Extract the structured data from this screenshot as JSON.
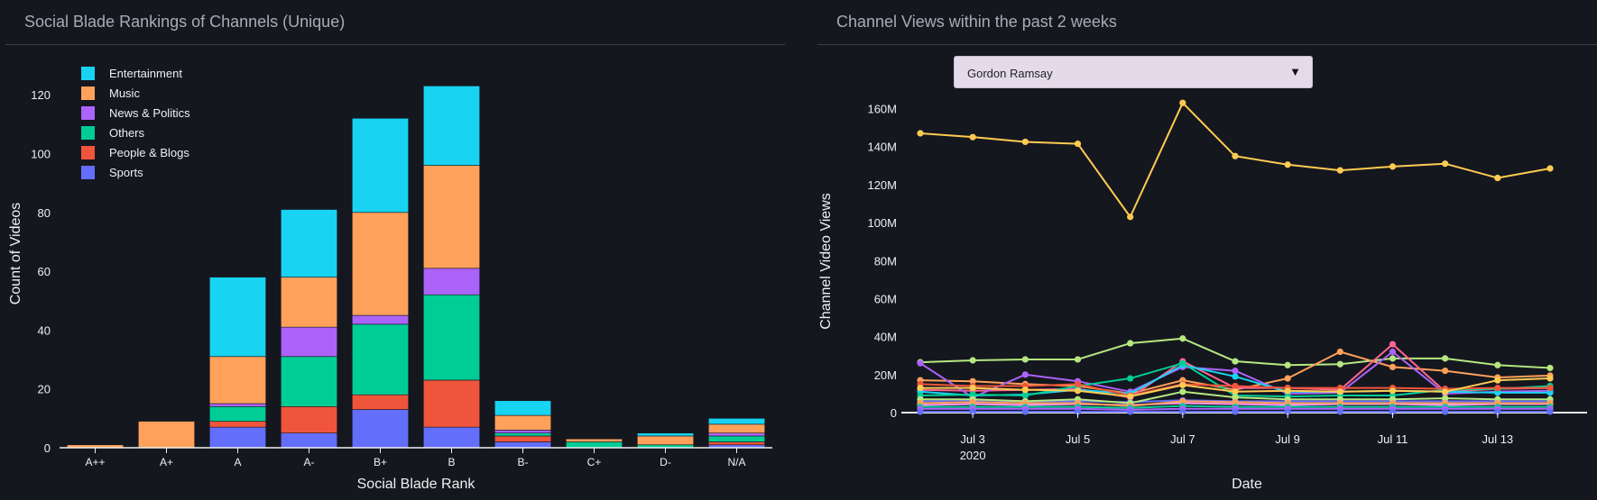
{
  "left_panel": {
    "title": "Social Blade Rankings of Channels (Unique)"
  },
  "right_panel": {
    "title": "Channel Views within the past 2 weeks",
    "dropdown": {
      "selected": "Gordon Ramsay"
    }
  },
  "chart_data": [
    {
      "type": "bar",
      "stacked": true,
      "xlabel": "Social Blade Rank",
      "ylabel": "Count of Videos",
      "ylim": [
        0,
        132
      ],
      "yticks": [
        0,
        20,
        40,
        60,
        80,
        100,
        120
      ],
      "grid": false,
      "legend_position": "top-left",
      "categories": [
        "A++",
        "A+",
        "A",
        "A-",
        "B+",
        "B",
        "B-",
        "C+",
        "D-",
        "N/A"
      ],
      "series": [
        {
          "name": "Sports",
          "color": "#636efa",
          "values": [
            0,
            0,
            7,
            5,
            13,
            7,
            2,
            0,
            0,
            1
          ]
        },
        {
          "name": "People & Blogs",
          "color": "#ef553b",
          "values": [
            0,
            0,
            2,
            9,
            5,
            16,
            2,
            0,
            0,
            1
          ]
        },
        {
          "name": "Others",
          "color": "#00cc96",
          "values": [
            0,
            0,
            5,
            17,
            24,
            29,
            1,
            2,
            1,
            2
          ]
        },
        {
          "name": "News & Politics",
          "color": "#ab63fa",
          "values": [
            0,
            0,
            1,
            10,
            3,
            9,
            1,
            0,
            0,
            1
          ]
        },
        {
          "name": "Music",
          "color": "#ffa15a",
          "values": [
            1,
            9,
            16,
            17,
            35,
            35,
            5,
            1,
            3,
            3
          ]
        },
        {
          "name": "Entertainment",
          "color": "#19d3f3",
          "values": [
            0,
            0,
            27,
            23,
            32,
            27,
            5,
            0,
            1,
            2
          ]
        }
      ],
      "legend_order": [
        "Entertainment",
        "Music",
        "News & Politics",
        "Others",
        "People & Blogs",
        "Sports"
      ]
    },
    {
      "type": "line",
      "xlabel": "Date",
      "ylabel": "Channel Video Views",
      "ylim": [
        0,
        165000000
      ],
      "yticks": [
        0,
        20000000,
        40000000,
        60000000,
        80000000,
        100000000,
        120000000,
        140000000,
        160000000
      ],
      "ytick_labels": [
        "0",
        "20M",
        "40M",
        "60M",
        "80M",
        "100M",
        "120M",
        "140M",
        "160M"
      ],
      "x": [
        "2020-07-02",
        "2020-07-03",
        "2020-07-04",
        "2020-07-05",
        "2020-07-06",
        "2020-07-07",
        "2020-07-08",
        "2020-07-09",
        "2020-07-10",
        "2020-07-11",
        "2020-07-12",
        "2020-07-13",
        "2020-07-14"
      ],
      "xticks": [
        "2020-07-03",
        "2020-07-05",
        "2020-07-07",
        "2020-07-09",
        "2020-07-11",
        "2020-07-13"
      ],
      "xtick_labels": [
        "Jul 3",
        "Jul 5",
        "Jul 7",
        "Jul 9",
        "Jul 11",
        "Jul 13"
      ],
      "xtick_sublabel": "2020",
      "grid": false,
      "series": [
        {
          "color": "#fecb52",
          "values": [
            147000000,
            145000000,
            142500000,
            141500000,
            103000000,
            163000000,
            135000000,
            130500000,
            127500000,
            129500000,
            131000000,
            123500000,
            128500000
          ]
        },
        {
          "color": "#b6e880",
          "values": [
            26500000,
            27500000,
            28000000,
            28000000,
            36500000,
            39000000,
            27000000,
            25000000,
            25500000,
            28500000,
            28500000,
            25000000,
            23500000
          ]
        },
        {
          "color": "#ffa15a",
          "values": [
            17000000,
            16500000,
            15000000,
            14000000,
            10000000,
            17000000,
            12000000,
            18000000,
            32000000,
            24000000,
            22000000,
            18500000,
            19500000
          ]
        },
        {
          "color": "#ff6692",
          "values": [
            12000000,
            11500000,
            12000000,
            12500000,
            8000000,
            27000000,
            13000000,
            13000000,
            12000000,
            36000000,
            11000000,
            12500000,
            13000000
          ]
        },
        {
          "color": "#ab63fa",
          "values": [
            26000000,
            8000000,
            20000000,
            16500000,
            11000000,
            24000000,
            22000000,
            10000000,
            10500000,
            32000000,
            10000000,
            11000000,
            11500000
          ]
        },
        {
          "color": "#19d3f3",
          "values": [
            11000000,
            9000000,
            9500000,
            12000000,
            10000000,
            25000000,
            19000000,
            11000000,
            11000000,
            11500000,
            11000000,
            10500000,
            10500000
          ]
        },
        {
          "color": "#00cc96",
          "values": [
            9000000,
            9500000,
            9000000,
            14000000,
            18000000,
            26000000,
            9000000,
            8500000,
            9000000,
            9000000,
            12000000,
            12500000,
            14000000
          ]
        },
        {
          "color": "#ef553b",
          "values": [
            15000000,
            14000000,
            14000000,
            15000000,
            9000000,
            15000000,
            14000000,
            13000000,
            13000000,
            13000000,
            12500000,
            13000000,
            13000000
          ]
        },
        {
          "color": "#636efa",
          "values": [
            6000000,
            6500000,
            6000000,
            6000000,
            5500000,
            6500000,
            6000000,
            6000000,
            6000000,
            6000000,
            6000000,
            6000000,
            6000000
          ]
        },
        {
          "color": "#ff97ff",
          "values": [
            4000000,
            4500000,
            4000000,
            4500000,
            4000000,
            5000000,
            4500000,
            4000000,
            4500000,
            4500000,
            4000000,
            4500000,
            4500000
          ]
        },
        {
          "color": "#fecb52",
          "values": [
            13000000,
            13000000,
            12000000,
            11500000,
            8500000,
            14500000,
            11000000,
            11500000,
            11000000,
            11500000,
            11000000,
            17000000,
            18000000
          ]
        },
        {
          "color": "#b6e880",
          "values": [
            7000000,
            7000000,
            6000000,
            7000000,
            5000000,
            11000000,
            8000000,
            7000000,
            7000000,
            7000000,
            7500000,
            7000000,
            7000000
          ]
        },
        {
          "color": "#ffa15a",
          "values": [
            5000000,
            5500000,
            5000000,
            5000000,
            3500000,
            6000000,
            5500000,
            5000000,
            5000000,
            5000000,
            5000000,
            5000000,
            5000000
          ]
        },
        {
          "color": "#00cc96",
          "values": [
            3000000,
            3000000,
            3000000,
            3000000,
            2500000,
            3500000,
            3000000,
            3000000,
            3000000,
            3000000,
            3000000,
            3000000,
            3000000
          ]
        },
        {
          "color": "#ab63fa",
          "values": [
            2000000,
            2000000,
            2000000,
            2000000,
            1500000,
            2000000,
            2000000,
            2000000,
            2000000,
            2000000,
            2000000,
            2000000,
            2000000
          ]
        },
        {
          "color": "#636efa",
          "values": [
            500000,
            500000,
            500000,
            500000,
            500000,
            500000,
            500000,
            500000,
            500000,
            500000,
            500000,
            500000,
            500000
          ]
        }
      ]
    }
  ]
}
